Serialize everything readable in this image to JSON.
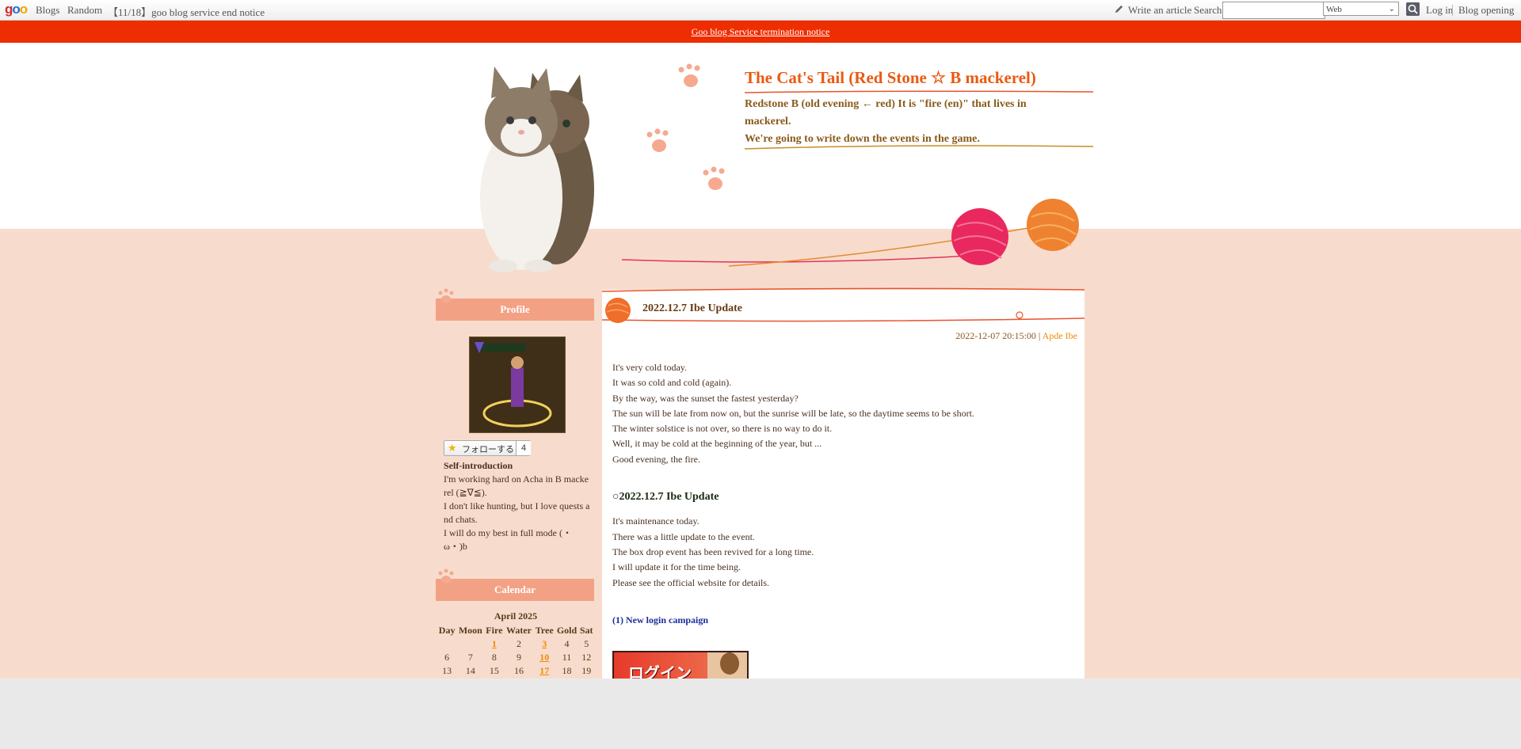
{
  "topbar": {
    "logo": "goo",
    "nav": [
      "Blogs",
      "Random"
    ],
    "notice_link": "【11/18】goo blog service end notice",
    "write_article": "Write an article",
    "search_label": "Search",
    "search_value": "",
    "search_scope": "Web",
    "login": "Log in",
    "blog_opening": "Blog opening"
  },
  "notice_bar": {
    "text": "Goo blog Service termination notice"
  },
  "blog": {
    "title": "The Cat's Tail (Red Stone ☆ B mackerel)",
    "description_line1": "Redstone B (old evening ← red) It is \"fire (en)\" that lives in mackerel.",
    "description_line2": "We're going to write down the events in the game."
  },
  "sidebar": {
    "profile_heading": "Profile",
    "follow_label": "フォローする",
    "follow_count": "4",
    "self_intro_title": "Self-introduction",
    "self_intro_lines": [
      "I'm working hard on Acha in B macke rel (≧∇≦).",
      "I don't like hunting, but I love quests a nd chats.",
      "I will do my best in full mode (・ω・)b"
    ],
    "calendar_heading": "Calendar",
    "calendar": {
      "month": "April 2025",
      "weekdays": [
        "Day",
        "Moon",
        "Fire",
        "Water",
        "Tree",
        "Gold",
        "Sat"
      ],
      "weeks": [
        [
          "",
          "",
          "1",
          "2",
          "3",
          "4",
          "5"
        ],
        [
          "6",
          "7",
          "8",
          "9",
          "10",
          "11",
          "12"
        ],
        [
          "13",
          "14",
          "15",
          "16",
          "17",
          "18",
          "19"
        ]
      ],
      "linked_days": [
        "1",
        "3",
        "10",
        "17"
      ]
    }
  },
  "entry": {
    "title": "2022.12.7 Ibe Update",
    "date": "2022-12-07 20:15:00",
    "separator": " | ",
    "author": "Apde Ibe",
    "paragraph1": [
      "It's very cold today.",
      "It was so cold and cold (again).",
      "By the way, was the sunset the fastest yesterday?",
      "The sun will be late from now on, but the sunrise will be late, so the daytime seems to be short.",
      "The winter solstice is not over, so there is no way to do it.",
      "Well, it may be cold at the beginning of the year, but ...",
      "Good evening, the fire."
    ],
    "section_heading": "○2022.12.7 Ibe Update",
    "paragraph2": [
      "It's maintenance today.",
      "There was a little update to the event.",
      "The box drop event has been revived for a long time.",
      "I will update it for the time being.",
      "Please see the official website for details."
    ],
    "subheading": "(1) New login campaign",
    "banner_text": "ログイン"
  },
  "colors": {
    "notice_bar": "#ee2e00",
    "title_orange": "#e95a12",
    "sidebar_heading": "#f3a185",
    "pink_band": "#f7dccd",
    "link_orange": "#f08a00"
  }
}
